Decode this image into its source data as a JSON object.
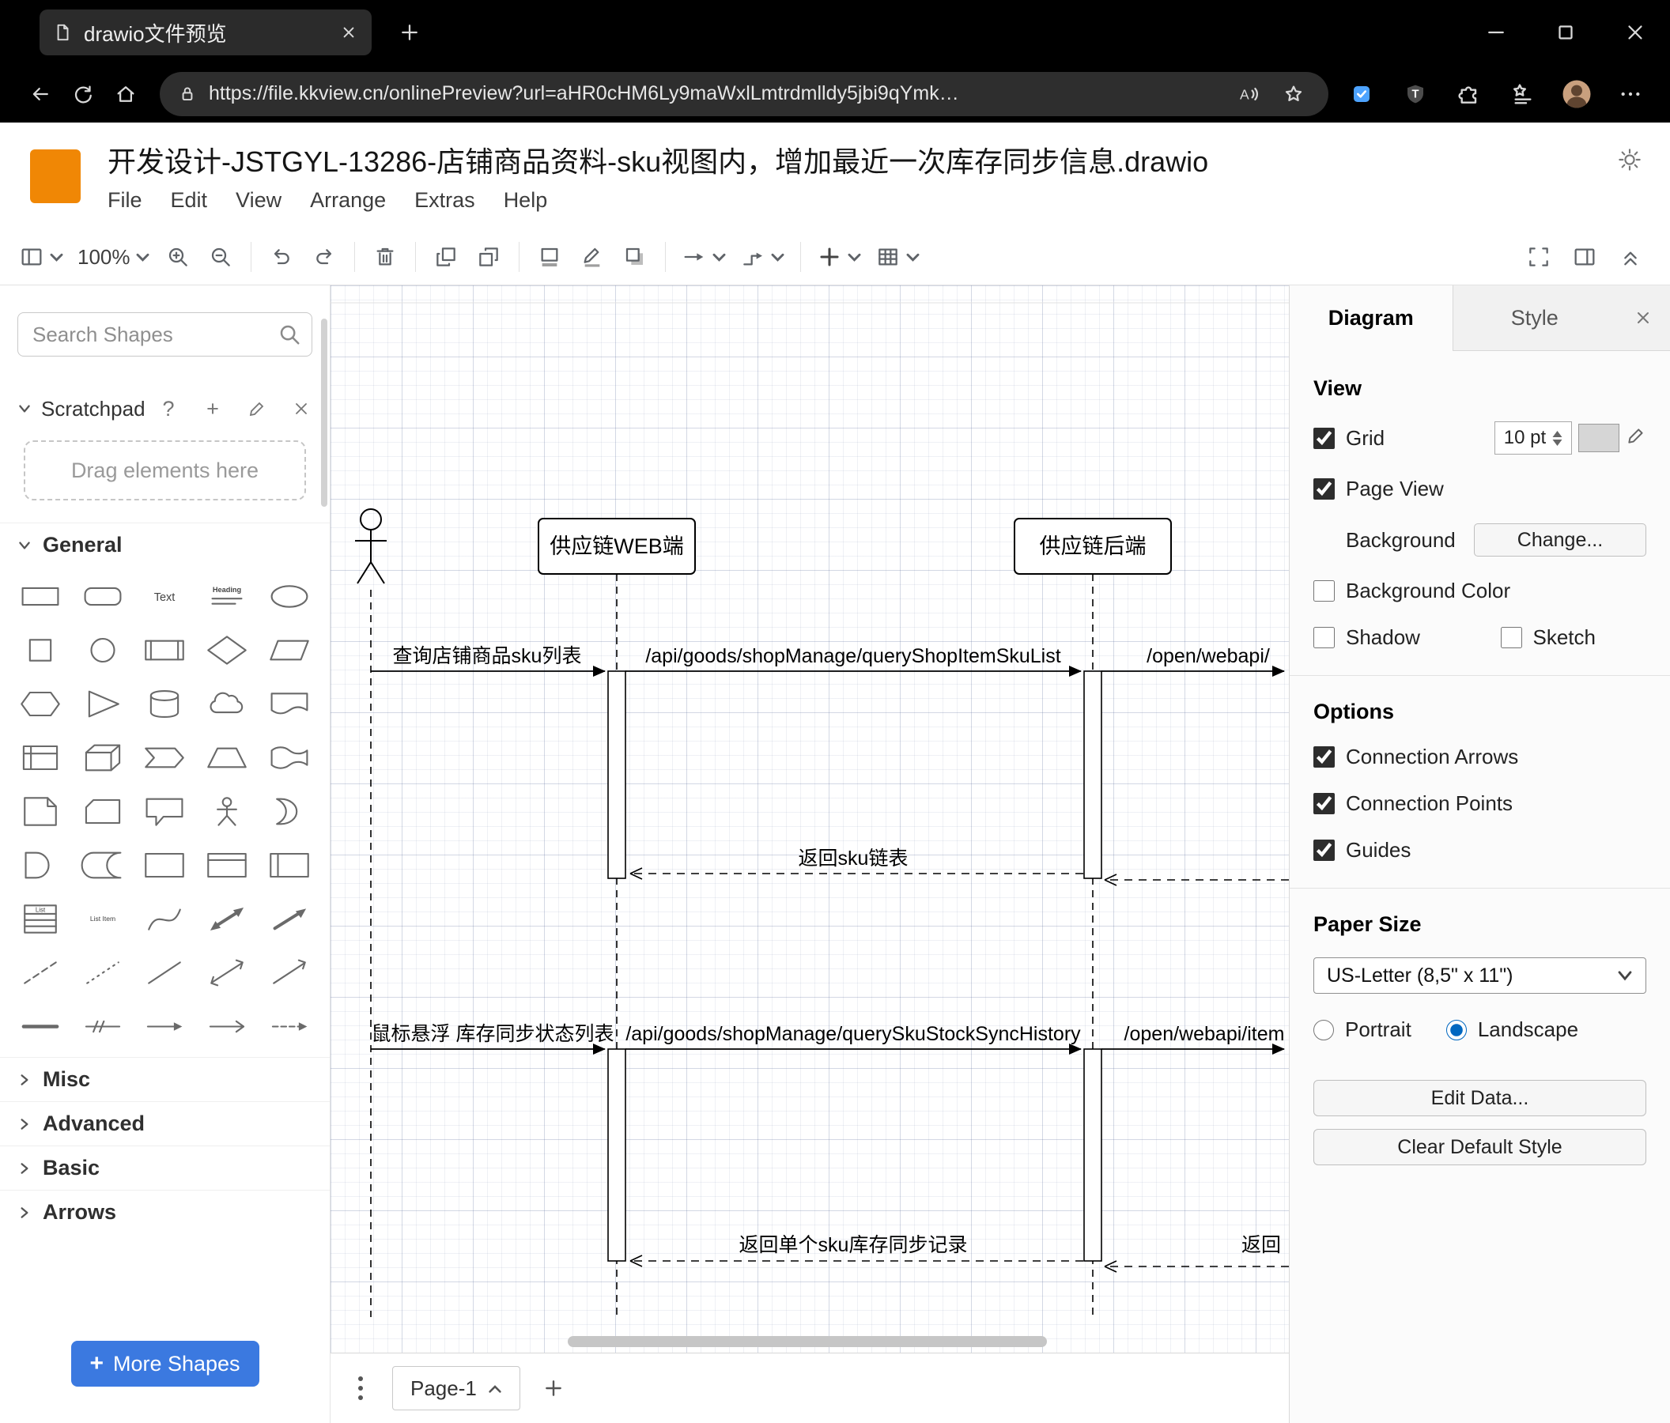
{
  "browser": {
    "tab_title": "drawio文件预览",
    "url": "https://file.kkview.cn/onlinePreview?url=aHR0cHM6Ly9maWxlLmtrdmlldy5jbi9qYmk…",
    "read_aloud_letter": "A",
    "shield_letter": "T",
    "icons": [
      "document",
      "tab-close",
      "new-tab",
      "minimize",
      "maximize",
      "close",
      "back",
      "refresh",
      "home",
      "lock",
      "read-aloud",
      "favorite-star",
      "pinned-extension",
      "shield-extension",
      "extensions-puzzle",
      "favorites-list",
      "profile-avatar",
      "settings-ellipsis"
    ]
  },
  "app": {
    "doc_title": "开发设计-JSTGYL-13286-店铺商品资料-sku视图内，增加最近一次库存同步信息.drawio",
    "menus": [
      "File",
      "Edit",
      "View",
      "Arrange",
      "Extras",
      "Help"
    ],
    "toolbar": {
      "zoom": "100%",
      "icons": [
        "view-outline",
        "zoom-level",
        "zoom-in",
        "zoom-out",
        "undo",
        "redo",
        "delete",
        "to-front",
        "to-back",
        "fill-color",
        "line-color",
        "shadow",
        "connection",
        "waypoints",
        "insert",
        "table",
        "fullscreen",
        "format-panel",
        "collapse"
      ]
    }
  },
  "sidebar": {
    "search_placeholder": "Search Shapes",
    "scratchpad_label": "Scratchpad",
    "drag_hint": "Drag elements here",
    "sections": {
      "general": "General",
      "misc": "Misc",
      "advanced": "Advanced",
      "basic": "Basic",
      "arrows": "Arrows"
    },
    "more_shapes": "More Shapes",
    "shape_texts": {
      "text": "Text",
      "heading": "Heading",
      "list": "List",
      "list_item": "List Item"
    },
    "shapes": [
      "rectangle",
      "rounded-rectangle",
      "text",
      "heading",
      "ellipse",
      "square",
      "circle",
      "process",
      "diamond",
      "parallelogram",
      "hexagon",
      "triangle",
      "cylinder",
      "cloud",
      "document",
      "internal-storage",
      "cube",
      "step",
      "trapezoid",
      "tape",
      "note",
      "card",
      "callout",
      "actor",
      "or",
      "and",
      "data-storage",
      "container",
      "vertical-container",
      "horizontal-container",
      "list",
      "list-item",
      "curve",
      "bidirectional-arrow",
      "arrow",
      "dashed-line",
      "dotted-line",
      "line",
      "bidirectional-connector",
      "directional-connector",
      "horizontal-line",
      "link",
      "connector-arrow",
      "connector-open-arrow",
      "connector-filled-arrow"
    ]
  },
  "diagram": {
    "lifelines": {
      "web": "供应链WEB端",
      "backend": "供应链后端"
    },
    "messages": {
      "m1": "查询店铺商品sku列表",
      "m2": "/api/goods/shopManage/queryShopItemSkuList",
      "m3": "/open/webapi/",
      "r1": "返回sku链表",
      "m4": "鼠标悬浮 库存同步状态列表",
      "m5": "/api/goods/shopManage/querySkuStockSyncHistory",
      "m6": "/open/webapi/item",
      "r2": "返回单个sku库存同步记录",
      "r3": "返回"
    }
  },
  "footer": {
    "page_tab": "Page-1"
  },
  "panel": {
    "tabs": {
      "diagram": "Diagram",
      "style": "Style"
    },
    "view": {
      "heading": "View",
      "grid_label": "Grid",
      "grid_size": "10 pt",
      "grid_checked": true,
      "page_view_label": "Page View",
      "page_view_checked": true,
      "background_label": "Background",
      "change_button": "Change...",
      "background_color_label": "Background Color",
      "background_color_checked": false,
      "shadow_label": "Shadow",
      "shadow_checked": false,
      "sketch_label": "Sketch",
      "sketch_checked": false
    },
    "options": {
      "heading": "Options",
      "connection_arrows": "Connection Arrows",
      "connection_arrows_checked": true,
      "connection_points": "Connection Points",
      "connection_points_checked": true,
      "guides": "Guides",
      "guides_checked": true
    },
    "paper": {
      "heading": "Paper Size",
      "size_value": "US-Letter (8,5\" x 11\")",
      "portrait": "Portrait",
      "portrait_checked": false,
      "landscape": "Landscape",
      "landscape_checked": true
    },
    "edit_data_button": "Edit Data...",
    "clear_default_style_button": "Clear Default Style"
  }
}
